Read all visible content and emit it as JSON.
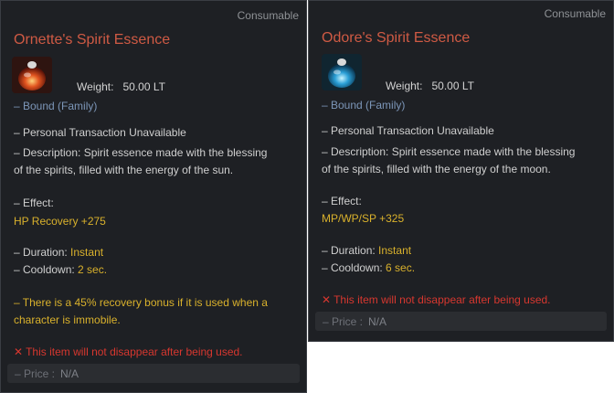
{
  "left": {
    "category": "Consumable",
    "title": "Ornette's Spirit Essence",
    "icon": "red-spirit-essence-potion-icon",
    "weight_label": "Weight:",
    "weight_value": "50.00 LT",
    "bound": "– Bound (Family)",
    "transaction": "– Personal Transaction Unavailable",
    "description_1": "– Description: Spirit essence made with the blessing",
    "description_2": "of the spirits, filled with the energy of the sun.",
    "effect_label": "– Effect:",
    "effect_value": "HP Recovery +275",
    "duration_label": "– Duration: ",
    "duration_value": "Instant",
    "cooldown_label": "– Cooldown: ",
    "cooldown_value": "2 sec.",
    "bonus_1": "– There is a 45% recovery bonus if it is used when a",
    "bonus_2": "character is immobile.",
    "not_disappear": "This item will not disappear after being used.",
    "price_label": "– Price :",
    "price_value": "N/A"
  },
  "right": {
    "category": "Consumable",
    "title": "Odore's Spirit Essence",
    "icon": "blue-spirit-essence-potion-icon",
    "weight_label": "Weight:",
    "weight_value": "50.00 LT",
    "bound": "– Bound (Family)",
    "transaction": "– Personal Transaction Unavailable",
    "description_1": "– Description: Spirit essence made with the blessing",
    "description_2": "of the spirits, filled with the energy of the moon.",
    "effect_label": "– Effect:",
    "effect_value": "MP/WP/SP +325",
    "duration_label": "– Duration: ",
    "duration_value": "Instant",
    "cooldown_label": "– Cooldown: ",
    "cooldown_value": "6 sec.",
    "not_disappear": "This item will not disappear after being used.",
    "price_label": "– Price :",
    "price_value": "N/A"
  },
  "colors": {
    "title": "#cf5a44",
    "effect": "#d9b12c",
    "warning": "#d7372f",
    "bound": "#7c96b8",
    "panel_bg": "#1e2024"
  }
}
